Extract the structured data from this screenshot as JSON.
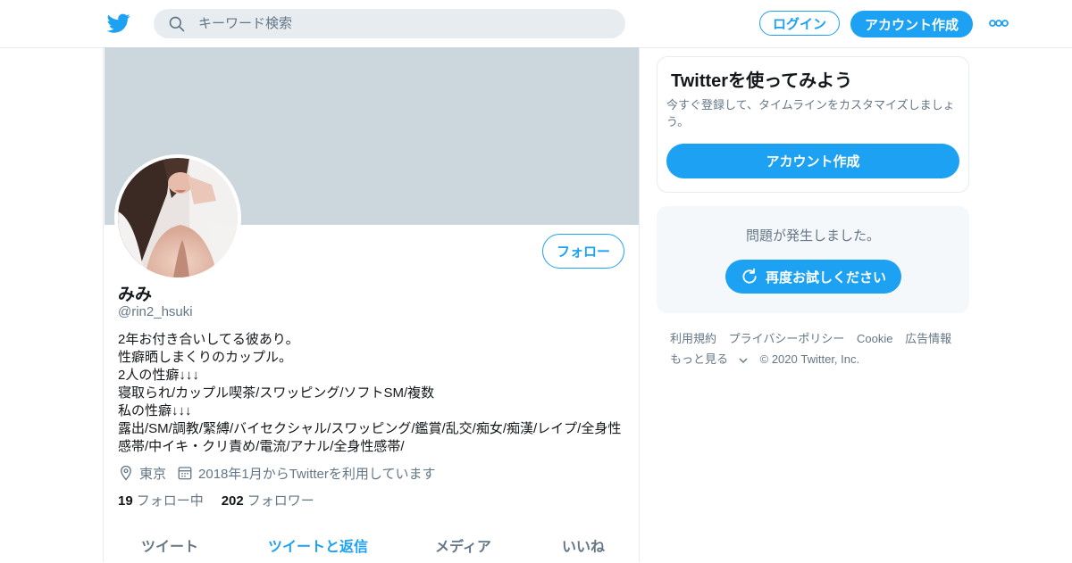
{
  "header": {
    "logo_icon": "twitter-bird-icon",
    "search_placeholder": "キーワード検索",
    "login_label": "ログイン",
    "signup_label": "アカウント作成",
    "more_icon": "more-dots-icon"
  },
  "profile": {
    "name": "みみ",
    "handle": "@rin2_hsuki",
    "follow_label": "フォロー",
    "bio_lines": [
      "2年お付き合いしてる彼あり。",
      "性癖晒しまくりのカップル。",
      "2人の性癖↓↓↓",
      "寝取られ/カップル喫茶/スワッピング/ソフトSM/複数",
      "私の性癖↓↓↓",
      "露出/SM/調教/緊縛/バイセクシャル/スワッピング/鑑賞/乱交/痴女/痴漢/レイプ/全身性",
      "感帯/中イキ・クリ責め/電流/アナル/全身性感帯/"
    ],
    "location": "東京",
    "joined": "2018年1月からTwitterを利用しています",
    "following_count": "19",
    "following_label": "フォロー中",
    "followers_count": "202",
    "followers_label": "フォロワー",
    "tabs": [
      "ツイート",
      "ツイートと返信",
      "メディア",
      "いいね"
    ],
    "active_tab": "ツイートと返信"
  },
  "sidebar": {
    "card_title": "Twitterを使ってみよう",
    "card_desc": "今すぐ登録して、タイムラインをカスタマイズしましょう。",
    "card_button": "アカウント作成",
    "error_message": "問題が発生しました。",
    "retry_label": "再度お試しください"
  },
  "footer": {
    "terms": "利用規約",
    "privacy": "プライバシーポリシー",
    "cookie": "Cookie",
    "ads": "広告情報",
    "more": "もっと見る",
    "copyright": "© 2020 Twitter, Inc."
  },
  "colors": {
    "accent": "#1da1f2",
    "banner": "#ccd6dd",
    "muted_text": "#657786",
    "border": "#e6ecf0"
  }
}
